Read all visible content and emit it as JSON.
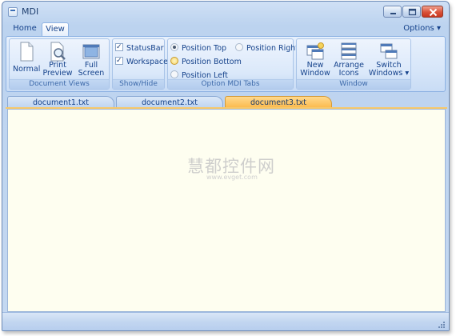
{
  "window": {
    "title": "MDI"
  },
  "ribbon_tabs": [
    {
      "label": "Home",
      "active": false
    },
    {
      "label": "View",
      "active": true
    }
  ],
  "options_label": "Options",
  "groups": {
    "document_views": {
      "label": "Document Views",
      "buttons": [
        {
          "line1": "Normal",
          "line2": ""
        },
        {
          "line1": "Print",
          "line2": "Preview"
        },
        {
          "line1": "Full",
          "line2": "Screen"
        }
      ]
    },
    "show_hide": {
      "label": "Show/Hide",
      "checks": [
        {
          "label": "StatusBar",
          "checked": true
        },
        {
          "label": "Workspace",
          "checked": true
        }
      ]
    },
    "option_mdi_tabs": {
      "label": "Option MDI Tabs",
      "radios": [
        {
          "label": "Position Top",
          "selected": true
        },
        {
          "label": "Position Right",
          "selected": false
        },
        {
          "label": "Position Bottom",
          "selected": false
        },
        {
          "label": "Position Left",
          "selected": false
        }
      ]
    },
    "window": {
      "label": "Window",
      "buttons": [
        {
          "line1": "New",
          "line2": "Window"
        },
        {
          "line1": "Arrange",
          "line2": "Icons"
        },
        {
          "line1": "Switch",
          "line2": "Windows ▾"
        }
      ]
    }
  },
  "doc_tabs": [
    {
      "label": "document1.txt",
      "active": false
    },
    {
      "label": "document2.txt",
      "active": false
    },
    {
      "label": "document3.txt",
      "active": true
    }
  ],
  "watermark": {
    "main": "慧都控件网",
    "sub": "www.evget.com"
  },
  "colors": {
    "active_tab": "#fbb94b",
    "document_bg": "#fefef0",
    "ribbon_text": "#15428b"
  }
}
